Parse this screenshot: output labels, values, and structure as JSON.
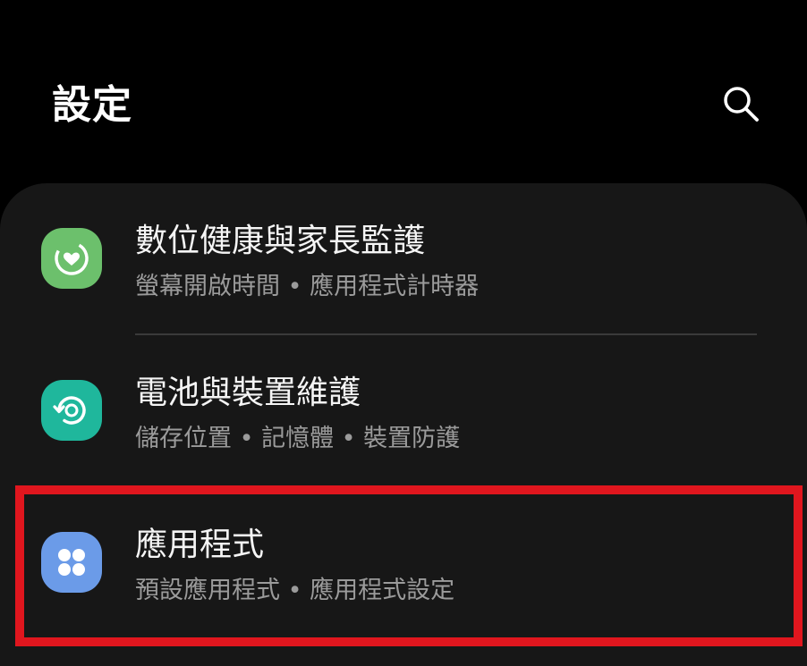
{
  "header": {
    "title": "設定",
    "search_icon": "search-icon"
  },
  "colors": {
    "background": "#000000",
    "card": "#171717",
    "highlight_border": "#e0161e",
    "digital_wellbeing_icon": "#6cc06c",
    "battery_care_icon": "#1fb79c",
    "apps_icon": "#6b9be8"
  },
  "settings": {
    "items": [
      {
        "title": "數位健康與家長監護",
        "subtitle": "螢幕開啟時間 • 應用程式計時器",
        "icon": "digital-wellbeing-icon"
      },
      {
        "title": "電池與裝置維護",
        "subtitle": "儲存位置 • 記憶體 • 裝置防護",
        "icon": "device-care-icon"
      },
      {
        "title": "應用程式",
        "subtitle": "預設應用程式 • 應用程式設定",
        "icon": "apps-icon",
        "highlighted": true
      }
    ]
  }
}
